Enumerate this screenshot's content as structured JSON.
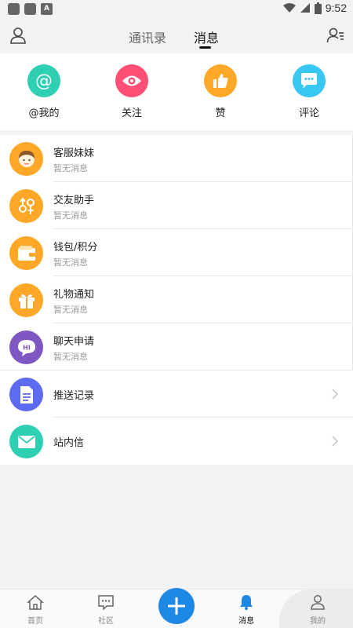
{
  "status_bar": {
    "time": "9:52",
    "badge": "A"
  },
  "header": {
    "tabs": [
      {
        "label": "通讯录",
        "active": false
      },
      {
        "label": "消息",
        "active": true
      }
    ]
  },
  "quick_actions": [
    {
      "label": "@我的",
      "icon": "at-icon",
      "color": "#2ecfb3"
    },
    {
      "label": "关注",
      "icon": "eye-icon",
      "color": "#ff4f74"
    },
    {
      "label": "赞",
      "icon": "thumbs-up-icon",
      "color": "#ffa726"
    },
    {
      "label": "评论",
      "icon": "comment-icon",
      "color": "#38c6f2"
    }
  ],
  "messages": [
    {
      "title": "客服妹妹",
      "subtitle": "暂无消息",
      "icon": "support-girl-icon",
      "color": "#ffa726"
    },
    {
      "title": "交友助手",
      "subtitle": "暂无消息",
      "icon": "gender-icon",
      "color": "#ffa726"
    },
    {
      "title": "钱包/积分",
      "subtitle": "暂无消息",
      "icon": "wallet-icon",
      "color": "#ffa726"
    },
    {
      "title": "礼物通知",
      "subtitle": "暂无消息",
      "icon": "gift-icon",
      "color": "#ffa726"
    },
    {
      "title": "聊天申请",
      "subtitle": "暂无消息",
      "icon": "hi-chat-icon",
      "color": "#7e57c2"
    }
  ],
  "links": [
    {
      "title": "推送记录",
      "icon": "document-icon",
      "color": "#5c6bf0"
    },
    {
      "title": "站内信",
      "icon": "mail-icon",
      "color": "#2ecfb3"
    }
  ],
  "bottom_nav": [
    {
      "label": "首页",
      "icon": "home-icon",
      "active": false
    },
    {
      "label": "社区",
      "icon": "community-icon",
      "active": false
    },
    {
      "label": "消息",
      "icon": "bell-icon",
      "active": true
    },
    {
      "label": "我的",
      "icon": "profile-icon",
      "active": false
    }
  ]
}
